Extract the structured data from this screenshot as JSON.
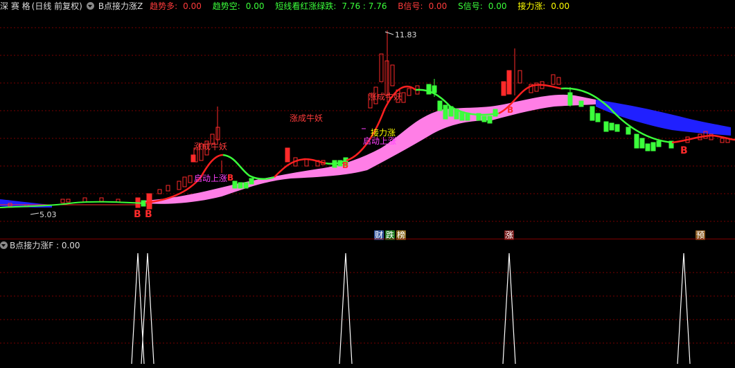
{
  "header": {
    "stock_name": "深 赛 格",
    "period": "(日线 前复权)",
    "indicator": "B点接力涨Z",
    "fields": [
      {
        "label": "趋势多:",
        "value": "0.00",
        "color": "#ff3b3b"
      },
      {
        "label": "趋势空:",
        "value": "0.00",
        "color": "#3bff3b"
      },
      {
        "label": "短线看红涨绿跌:",
        "value": "7.76 : 7.76",
        "color": "#3bff3b"
      },
      {
        "label": "B信号:",
        "value": "0.00",
        "color": "#ff3b3b"
      },
      {
        "label": "S信号:",
        "value": "0.00",
        "color": "#3bff3b"
      },
      {
        "label": "接力涨:",
        "value": "0.00",
        "color": "#ffff00"
      }
    ]
  },
  "price_labels": {
    "high": "11.83",
    "low": "5.03"
  },
  "annotations": {
    "zhangchengniuyao": "涨成牛妖",
    "qidongshangzhang": "启动上涨",
    "jielizhang": "接力涨",
    "b": "B"
  },
  "signal_tags": [
    {
      "text": "财",
      "bg": "#3a5aa0",
      "fg": "#ffffff"
    },
    {
      "text": "跌",
      "bg": "#1f7a1f",
      "fg": "#ffffff"
    },
    {
      "text": "榜",
      "bg": "#8a6a20",
      "fg": "#ffffff"
    },
    {
      "text": "涨",
      "bg": "#7a1f1f",
      "fg": "#ffffff"
    },
    {
      "text": "预",
      "bg": "#8a5a20",
      "fg": "#ffffff"
    }
  ],
  "sub_panel": {
    "title": "B点接力涨F",
    "value": ": 0.00"
  },
  "colors": {
    "up": "#ff2a2a",
    "down": "#3bff3b",
    "ribbon_pink": "#ff7ee6",
    "ribbon_blue": "#2020ff",
    "grid": "#7a0000"
  }
}
